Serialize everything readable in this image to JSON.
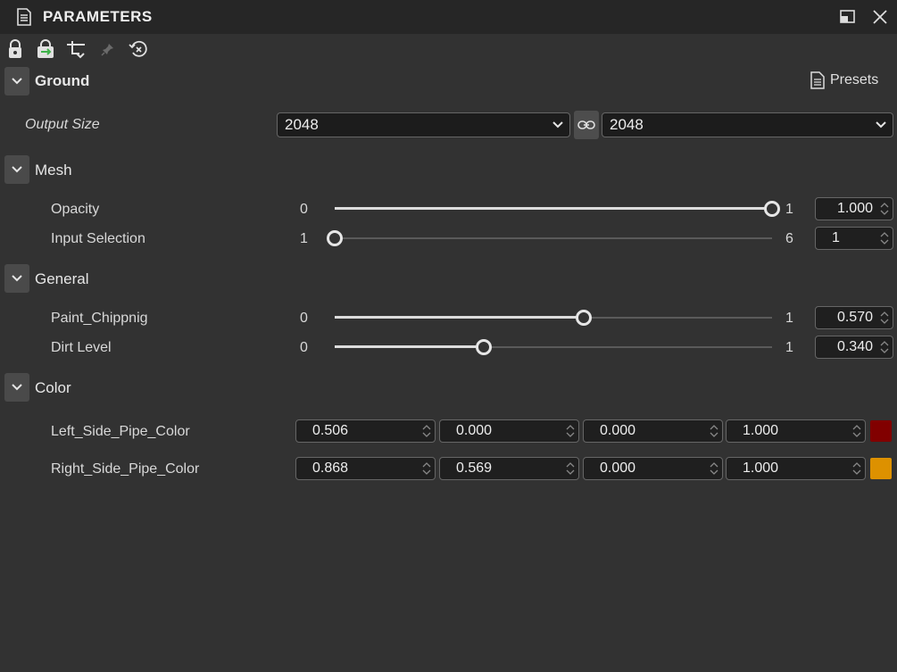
{
  "window": {
    "title": "PARAMETERS"
  },
  "toolbar": {
    "icons": [
      "lock-icon",
      "refresh-lock-icon",
      "flow-arrow-icon",
      "pin-icon",
      "reset-icon"
    ]
  },
  "ground": {
    "label": "Ground",
    "presets_label": "Presets",
    "output_size": {
      "label": "Output Size",
      "width": "2048",
      "height": "2048"
    }
  },
  "mesh": {
    "label": "Mesh",
    "opacity": {
      "label": "Opacity",
      "min": "0",
      "max": "1",
      "value": "1.000",
      "fraction": 1.0
    },
    "input_selection": {
      "label": "Input Selection",
      "min": "1",
      "max": "6",
      "value": "1",
      "fraction": 0.0
    }
  },
  "general": {
    "label": "General",
    "paint_chipping": {
      "label": "Paint_Chippnig",
      "min": "0",
      "max": "1",
      "value": "0.570",
      "fraction": 0.57
    },
    "dirt_level": {
      "label": "Dirt Level",
      "min": "0",
      "max": "1",
      "value": "0.340",
      "fraction": 0.34
    }
  },
  "color": {
    "label": "Color",
    "left_pipe": {
      "label": "Left_Side_Pipe_Color",
      "r": "0.506",
      "g": "0.000",
      "b": "0.000",
      "a": "1.000",
      "swatch": "#810000"
    },
    "right_pipe": {
      "label": "Right_Side_Pipe_Color",
      "r": "0.868",
      "g": "0.569",
      "b": "0.000",
      "a": "1.000",
      "swatch": "#DD9100"
    }
  }
}
